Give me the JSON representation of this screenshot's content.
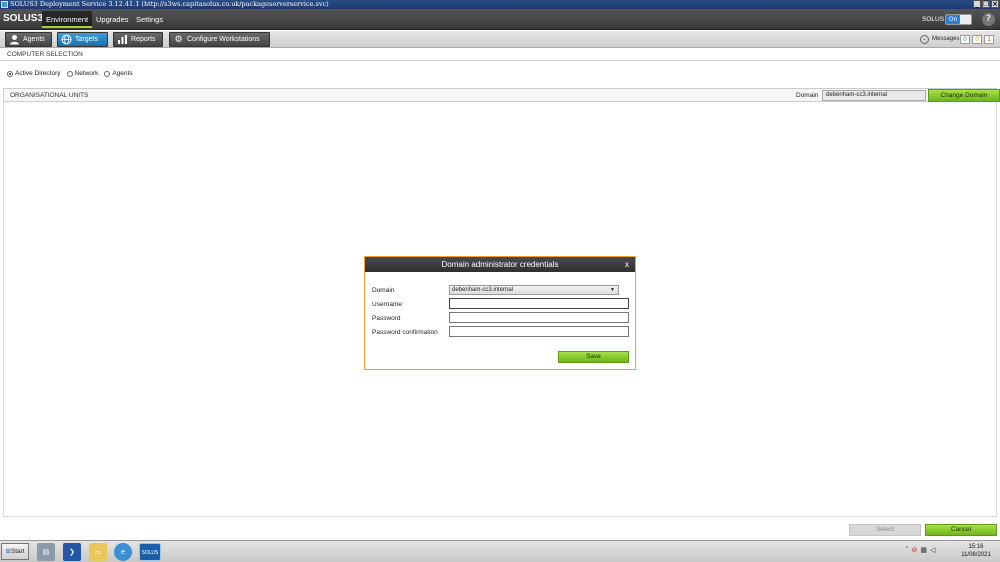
{
  "window": {
    "title": "SOLUS3 Deployment Service 3.12.41.1 (http://s3ws.capitasolus.co.uk/packageserverservice.svc)"
  },
  "mainnav": {
    "brand": "SOLUS3",
    "tabs": [
      {
        "label": "Environment",
        "active": true
      },
      {
        "label": "Upgrades",
        "active": false
      },
      {
        "label": "Settings",
        "active": false
      }
    ],
    "solus_label": "SOLUS",
    "toggle_label": "On",
    "help": "?"
  },
  "subnav": {
    "buttons": [
      {
        "label": "Agents",
        "icon": "user-icon"
      },
      {
        "label": "Targets",
        "icon": "globe-icon",
        "active": true
      },
      {
        "label": "Reports",
        "icon": "bar-chart-icon"
      },
      {
        "label": "Configure Workstations",
        "icon": "gear-icon"
      }
    ],
    "messages_label": "Messages",
    "message_counts": [
      "0",
      "0",
      "1"
    ]
  },
  "content": {
    "section_title": "COMPUTER SELECTION",
    "radios": [
      {
        "label": "Active Directory",
        "checked": true
      },
      {
        "label": "Network",
        "checked": false
      },
      {
        "label": "Agents",
        "checked": false
      }
    ],
    "ou_title": "ORGANISATIONAL UNITS",
    "domain_label": "Domain",
    "domain_value": "debenham-cc3.internal",
    "change_domain": "Change Domain"
  },
  "dialog": {
    "title": "Domain administrator credentials",
    "close": "x",
    "domain_label": "Domain",
    "domain_selected": "debenham-cc3.internal",
    "username_label": "Username",
    "password_label": "Password",
    "password_confirm_label": "Password confirmation",
    "save": "Save"
  },
  "footer": {
    "select": "Select",
    "cancel": "Cancel"
  },
  "taskbar": {
    "start": "Start",
    "solus_app": "SOLUS",
    "time": "15:16",
    "date": "11/08/2021"
  },
  "colors": {
    "accent_green": "#8fcd34",
    "accent_blue": "#2d7fd3",
    "dialog_border": "#f0a030"
  }
}
